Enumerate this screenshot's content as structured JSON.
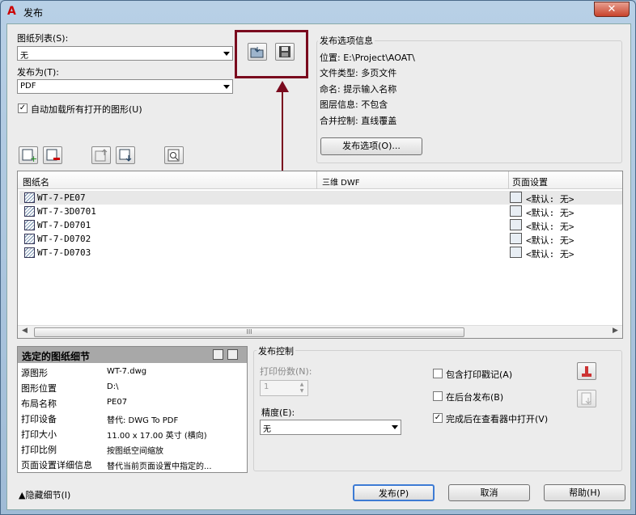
{
  "window": {
    "title": "发布",
    "close": "✕"
  },
  "sheet_list": {
    "label": "图纸列表(S):",
    "value": "无"
  },
  "publish_to": {
    "label": "发布为(T):",
    "value": "PDF"
  },
  "auto_load": {
    "label": "自动加载所有打开的图形(U)",
    "checked": true
  },
  "options_info": {
    "title": "发布选项信息",
    "lines": [
      "位置: E:\\Project\\AOAT\\",
      "文件类型: 多页文件",
      "命名: 提示输入名称",
      "图层信息: 不包含",
      "合并控制: 直线覆盖"
    ],
    "button": "发布选项(O)..."
  },
  "columns": [
    "图纸名",
    "三维 DWF",
    "页面设置"
  ],
  "rows": [
    {
      "name": "WT-7-PE07",
      "setup": "<默认: 无>"
    },
    {
      "name": "WT-7-3D0701",
      "setup": "<默认: 无>"
    },
    {
      "name": "WT-7-D0701",
      "setup": "<默认: 无>"
    },
    {
      "name": "WT-7-D0702",
      "setup": "<默认: 无>"
    },
    {
      "name": "WT-7-D0703",
      "setup": "<默认: 无>"
    }
  ],
  "scroll_grip": "III",
  "details": {
    "title": "选定的图纸细节",
    "items": [
      {
        "label": "源图形",
        "value": "WT-7.dwg"
      },
      {
        "label": "图形位置",
        "value": "D:\\"
      },
      {
        "label": "布局名称",
        "value": "PE07"
      },
      {
        "label": "打印设备",
        "value": "替代: DWG To PDF"
      },
      {
        "label": "打印大小",
        "value": "11.00 x 17.00 英寸 (横向)"
      },
      {
        "label": "打印比例",
        "value": "按图纸空间缩放"
      },
      {
        "label": "页面设置详细信息",
        "value": "替代当前页面设置中指定的..."
      }
    ]
  },
  "publish_control": {
    "title": "发布控制",
    "copies_label": "打印份数(N):",
    "copies_value": "1",
    "precision_label": "精度(E):",
    "precision_value": "无",
    "include_stamp": "包含打印戳记(A)",
    "background": "在后台发布(B)",
    "open_viewer": "完成后在查看器中打开(V)"
  },
  "footer": {
    "hide_details": "隐藏细节(I)",
    "publish": "发布(P)",
    "cancel": "取消",
    "help": "帮助(H)"
  },
  "colors": {
    "highlight": "#7a0a1e"
  }
}
